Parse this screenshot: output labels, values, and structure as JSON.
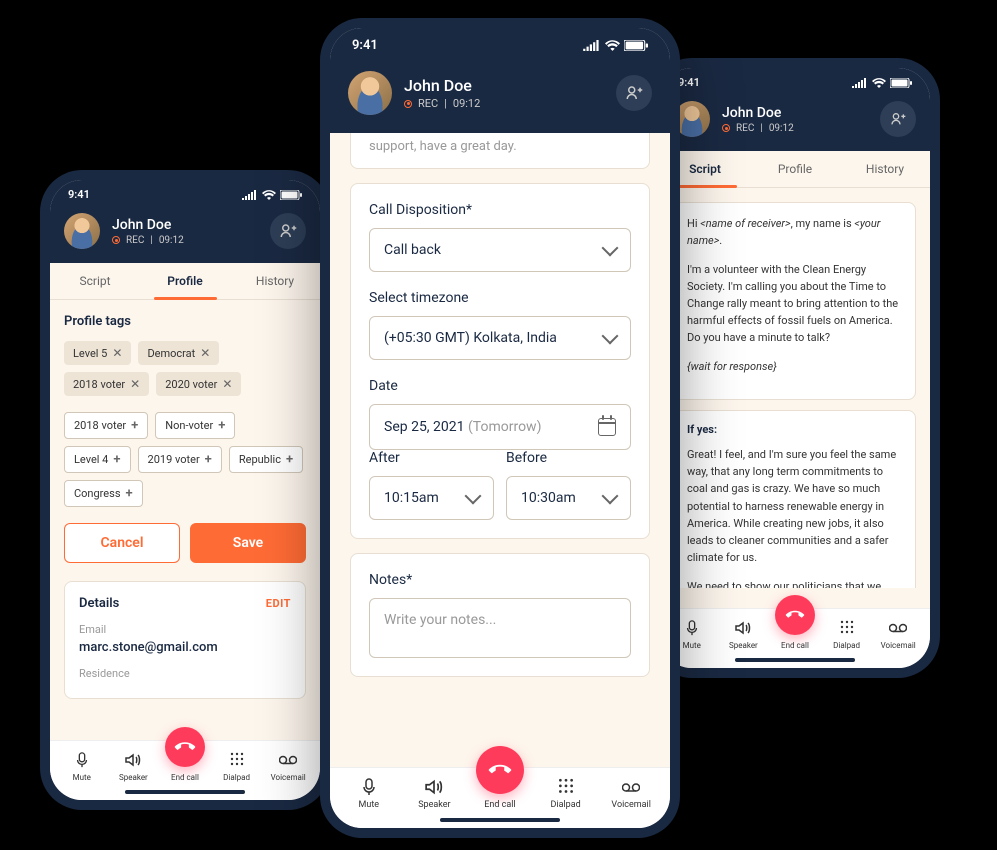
{
  "status_time": "9:41",
  "contact_name": "John Doe",
  "rec_label": "REC",
  "rec_time": "09:12",
  "tabs": {
    "script": "Script",
    "profile": "Profile",
    "history": "History"
  },
  "profile": {
    "tags_title": "Profile tags",
    "active_tags": [
      "Level 5",
      "Democrat",
      "2018 voter",
      "2020 voter"
    ],
    "add_tags": [
      "2018 voter",
      "Non-voter",
      "Level 4",
      "2019 voter",
      "Republic",
      "Congress"
    ],
    "cancel": "Cancel",
    "save": "Save",
    "details_title": "Details",
    "edit": "EDIT",
    "email_label": "Email",
    "email_value": "marc.stone@gmail.com",
    "residence_label": "Residence"
  },
  "form": {
    "top_fragment": "support, have a great day.",
    "disposition_label": "Call Disposition*",
    "disposition_value": "Call back",
    "timezone_label": "Select timezone",
    "timezone_value": "(+05:30 GMT) Kolkata, India",
    "date_label": "Date",
    "date_value": "Sep 25, 2021",
    "date_hint": "(Tomorrow)",
    "after_label": "After",
    "after_value": "10:15am",
    "before_label": "Before",
    "before_value": "10:30am",
    "notes_label": "Notes*",
    "notes_placeholder": "Write your notes..."
  },
  "script": {
    "intro_pre": "Hi ",
    "intro_var1": "<name of receiver>",
    "intro_mid": ", my name is ",
    "intro_var2": "<your name>",
    "intro_post": ".",
    "body1": "I'm a volunteer with the Clean Energy Society. I'm calling you about the Time to Change rally meant to bring attention to the harmful effects of fossil fuels on America. Do you have a minute to talk?",
    "wait": "{wait for response}",
    "if_yes": "If yes:",
    "body2": "Great! I feel, and I'm sure you feel the same way, that any long term commitments to coal and gas is crazy. We have so much potential to harness renewable energy in America. While creating new jobs, it also leads to cleaner communities and a safer climate for us.",
    "body3": "We need to show our politicians that we"
  },
  "nav": {
    "mute": "Mute",
    "speaker": "Speaker",
    "end_call": "End call",
    "dialpad": "Dialpad",
    "voicemail": "Voicemail"
  }
}
